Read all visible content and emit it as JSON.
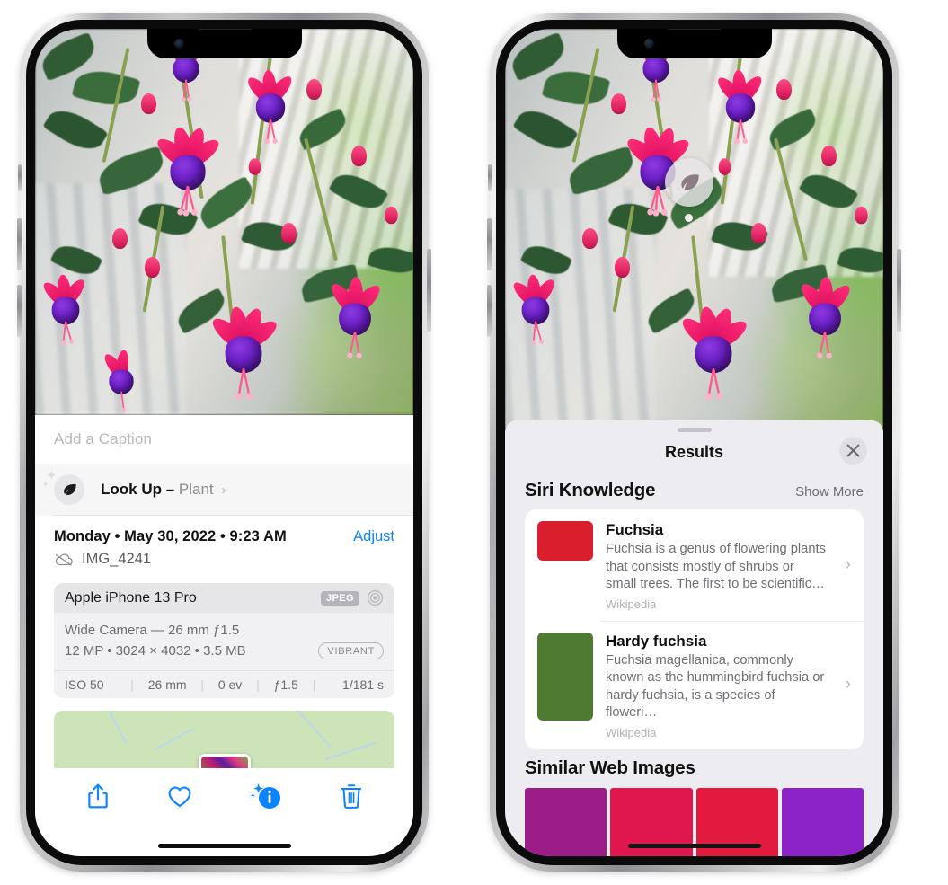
{
  "left_phone": {
    "caption_placeholder": "Add a Caption",
    "lookup": {
      "label": "Look Up –",
      "subject": "Plant",
      "chevron": "›",
      "icon": "leaf-icon"
    },
    "metadata": {
      "date_line": "Monday • May 30, 2022 • 9:23 AM",
      "adjust_label": "Adjust",
      "filename": "IMG_4241",
      "cloud_icon": "icloud-slash-icon"
    },
    "exif": {
      "model": "Apple iPhone 13 Pro",
      "format_tag": "JPEG",
      "lens_icon": "aperture-icon",
      "lens_line": "Wide Camera — 26 mm ƒ1.5",
      "size_line": "12 MP • 3024 × 4032 • 3.5 MB",
      "profile_tag": "VIBRANT",
      "stats": [
        "ISO 50",
        "26 mm",
        "0 ev",
        "ƒ1.5",
        "1/181 s"
      ]
    },
    "toolbar": [
      {
        "name": "share-button",
        "icon": "share-icon"
      },
      {
        "name": "favorite-button",
        "icon": "heart-icon"
      },
      {
        "name": "info-button",
        "icon": "info-sparkle-icon"
      },
      {
        "name": "delete-button",
        "icon": "trash-icon"
      }
    ]
  },
  "right_phone": {
    "photo_badge": {
      "icon": "leaf-icon",
      "label": "plant-detected-pin"
    },
    "sheet": {
      "title": "Results",
      "close_icon": "close-icon"
    },
    "siri_knowledge": {
      "title": "Siri Knowledge",
      "show_more": "Show More",
      "items": [
        {
          "title": "Fuchsia",
          "description": "Fuchsia is a genus of flowering plants that consists mostly of shrubs or small trees. The first to be scientific…",
          "source": "Wikipedia",
          "chevron": "›"
        },
        {
          "title": "Hardy fuchsia",
          "description": "Fuchsia magellanica, commonly known as the hummingbird fuchsia or hardy fuchsia, is a species of floweri…",
          "source": "Wikipedia",
          "chevron": "›"
        }
      ]
    },
    "similar_web_images": {
      "title": "Similar Web Images",
      "count": 4
    }
  },
  "colors": {
    "accent_blue": "#0a84ff",
    "sheet_bg": "#edecf1",
    "card_bg": "#ffffff",
    "secondary_text": "#6e6e74"
  }
}
